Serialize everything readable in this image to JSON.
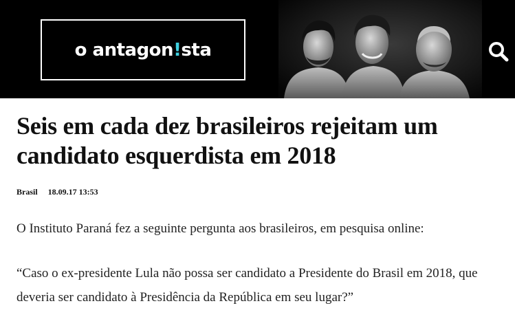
{
  "header": {
    "logo": {
      "pre": "o antagon",
      "accent": "!",
      "post": "sta",
      "accent_color": "#3fd0e0"
    },
    "search_icon": "search-icon",
    "photo": "three-hosts-portrait"
  },
  "article": {
    "title": "Seis em cada dez brasileiros rejeitam um candidato esquerdista em 2018",
    "section": "Brasil",
    "datetime": "18.09.17 13:53",
    "paragraphs": [
      "O Instituto Paraná fez a seguinte pergunta aos brasileiros, em pesquisa online:",
      "“Caso o ex-presidente Lula não possa ser candidato a Presidente do Brasil em 2018, que deveria ser candidato à Presidência da República em seu lugar?”"
    ]
  }
}
